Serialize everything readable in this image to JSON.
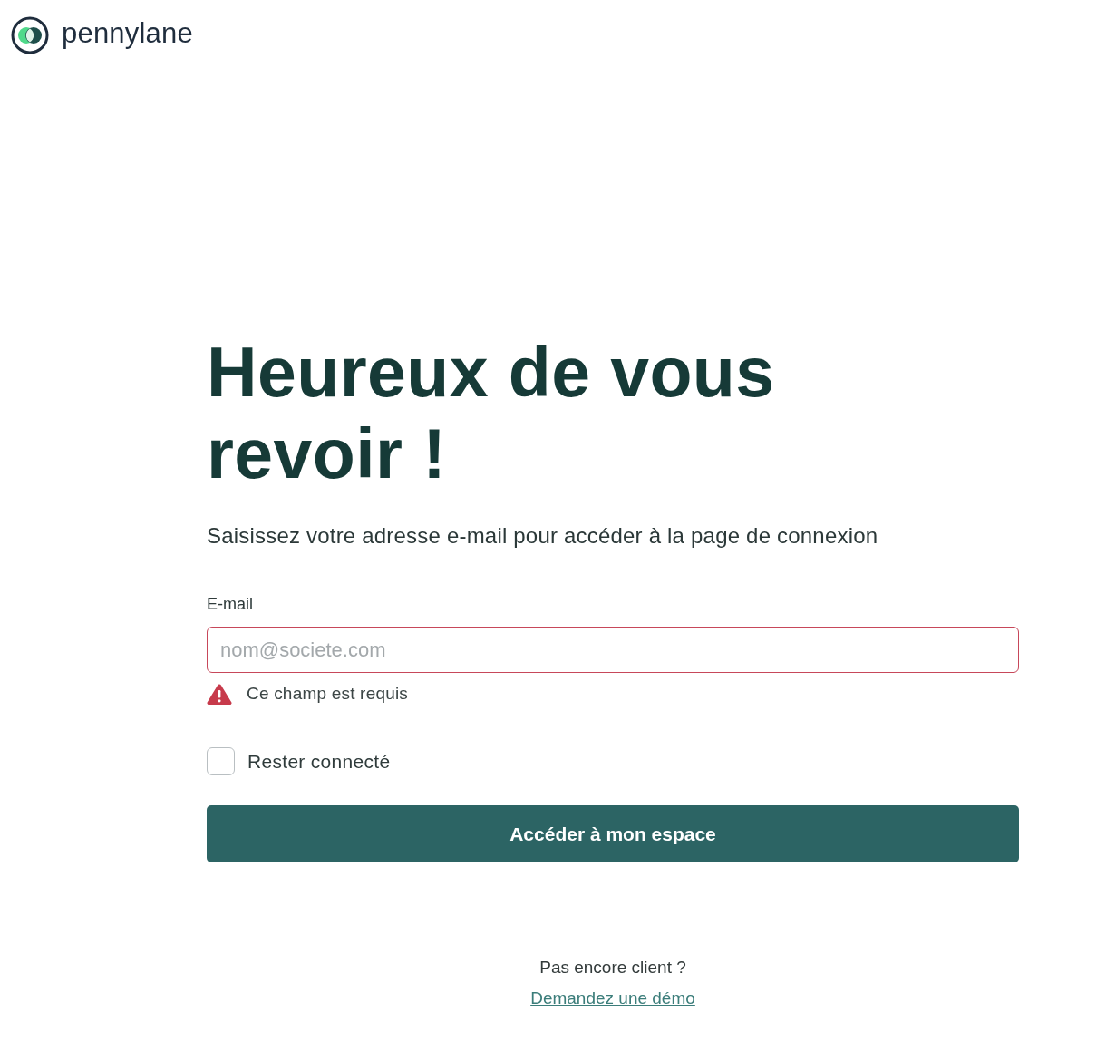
{
  "logo": {
    "name": "pennylane"
  },
  "heading": "Heureux de vous revoir !",
  "subtitle": "Saisissez votre adresse e-mail pour accéder à la page de connexion",
  "email_field": {
    "label": "E-mail",
    "placeholder": "nom@societe.com",
    "error": "Ce champ est requis"
  },
  "remember_me": {
    "label": "Rester connecté",
    "checked": false
  },
  "submit_button": {
    "label": "Accéder à mon espace"
  },
  "footer": {
    "prompt": "Pas encore client ?",
    "link": "Demandez une démo"
  }
}
